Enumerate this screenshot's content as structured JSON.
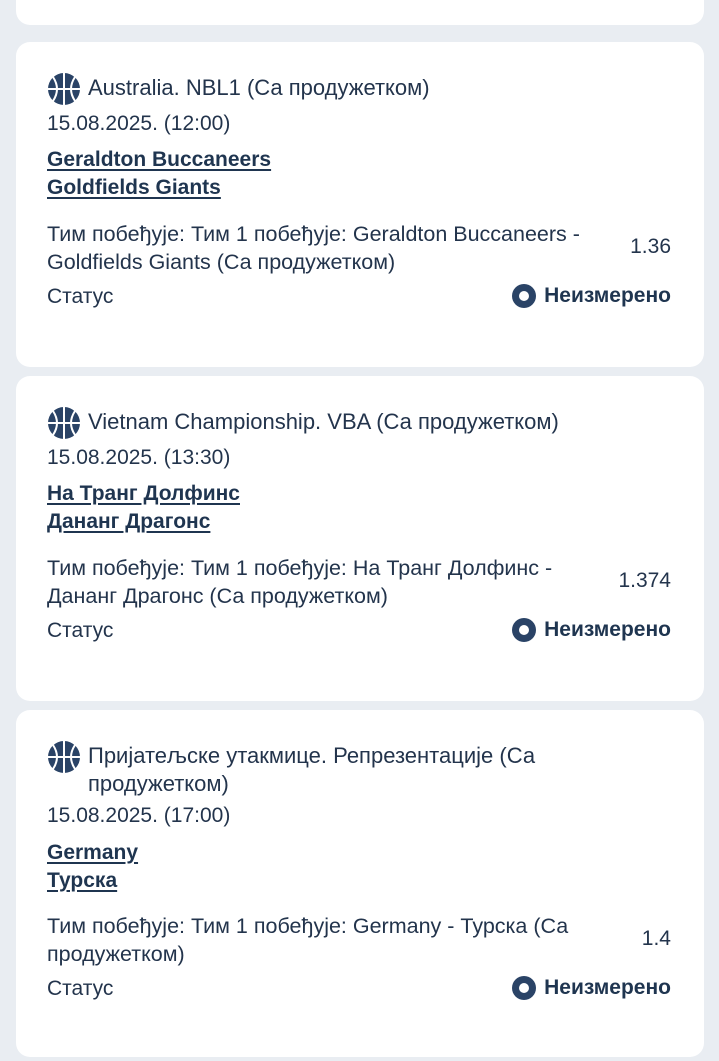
{
  "colors": {
    "background": "#e9edf2",
    "card": "#ffffff",
    "text": "#23344c",
    "icon": "#2a4366"
  },
  "bets": [
    {
      "league": "Australia. NBL1 (Са продужетком)",
      "datetime": "15.08.2025. (12:00)",
      "team1": "Geraldton Buccaneers",
      "team2": "Goldfields Giants",
      "market": "Тим побеђује: Тим 1 побеђује: Geraldton Buccaneers - Goldfields Giants (Са продужетком)",
      "odd": "1.36",
      "status_label": "Статус",
      "status_value": "Неизмерено",
      "sport_icon": "basketball-icon",
      "status_icon": "pending-circle-icon"
    },
    {
      "league": "Vietnam Championship. VBA (Са продужетком)",
      "datetime": "15.08.2025. (13:30)",
      "team1": "На Транг Долфинс",
      "team2": "Дананг Драгонс",
      "market": "Тим побеђује: Тим 1 побеђује: На Транг Долфинс - Дананг Драгонс (Са продужетком)",
      "odd": "1.374",
      "status_label": "Статус",
      "status_value": "Неизмерено",
      "sport_icon": "basketball-icon",
      "status_icon": "pending-circle-icon"
    },
    {
      "league": "Пријатељске утакмице. Репрезентације (Са продужетком)",
      "datetime": "15.08.2025. (17:00)",
      "team1": "Germany",
      "team2": "Турска",
      "market": "Тим побеђује: Тим 1 побеђује: Germany - Турска (Са продужетком)",
      "odd": "1.4",
      "status_label": "Статус",
      "status_value": "Неизмерено",
      "sport_icon": "basketball-icon",
      "status_icon": "pending-circle-icon"
    }
  ]
}
